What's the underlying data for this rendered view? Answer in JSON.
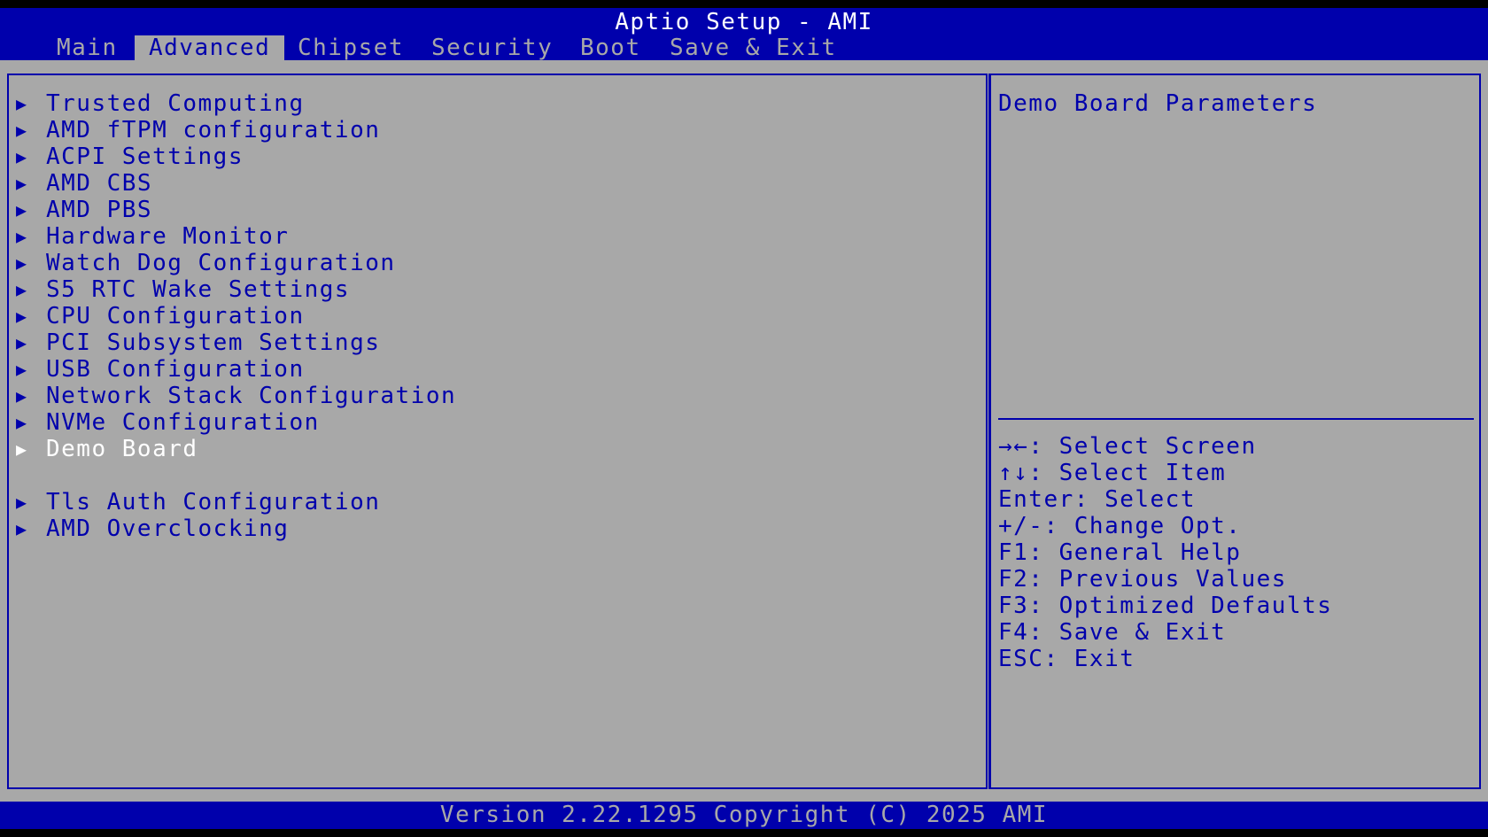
{
  "header": {
    "title": "Aptio Setup - AMI",
    "tabs": [
      {
        "label": "Main",
        "active": false
      },
      {
        "label": "Advanced",
        "active": true
      },
      {
        "label": "Chipset",
        "active": false
      },
      {
        "label": "Security",
        "active": false
      },
      {
        "label": "Boot",
        "active": false
      },
      {
        "label": "Save & Exit",
        "active": false
      }
    ]
  },
  "menu": {
    "arrow_glyph": "▶",
    "items": [
      {
        "label": "Trusted Computing"
      },
      {
        "label": "AMD fTPM configuration"
      },
      {
        "label": "ACPI Settings"
      },
      {
        "label": "AMD CBS"
      },
      {
        "label": "AMD PBS"
      },
      {
        "label": "Hardware Monitor"
      },
      {
        "label": "Watch Dog Configuration"
      },
      {
        "label": "S5 RTC Wake Settings"
      },
      {
        "label": "CPU Configuration"
      },
      {
        "label": "PCI Subsystem Settings"
      },
      {
        "label": "USB Configuration"
      },
      {
        "label": "Network Stack Configuration"
      },
      {
        "label": "NVMe Configuration"
      },
      {
        "label": "Demo Board",
        "selected": true
      },
      {
        "label": "Tls Auth Configuration"
      },
      {
        "label": "AMD Overclocking"
      }
    ]
  },
  "help": {
    "description": "Demo Board Parameters",
    "keys": [
      "→←: Select Screen",
      "↑↓: Select Item",
      "Enter: Select",
      "+/-: Change Opt.",
      "F1: General Help",
      "F2: Previous Values",
      "F3: Optimized Defaults",
      "F4: Save & Exit",
      "ESC: Exit"
    ]
  },
  "footer": {
    "version": "Version 2.22.1295 Copyright (C) 2025 AMI"
  },
  "colors": {
    "bios_blue": "#0000ac",
    "bios_gray": "#a8a8a8",
    "selected_text": "#ffffff"
  }
}
